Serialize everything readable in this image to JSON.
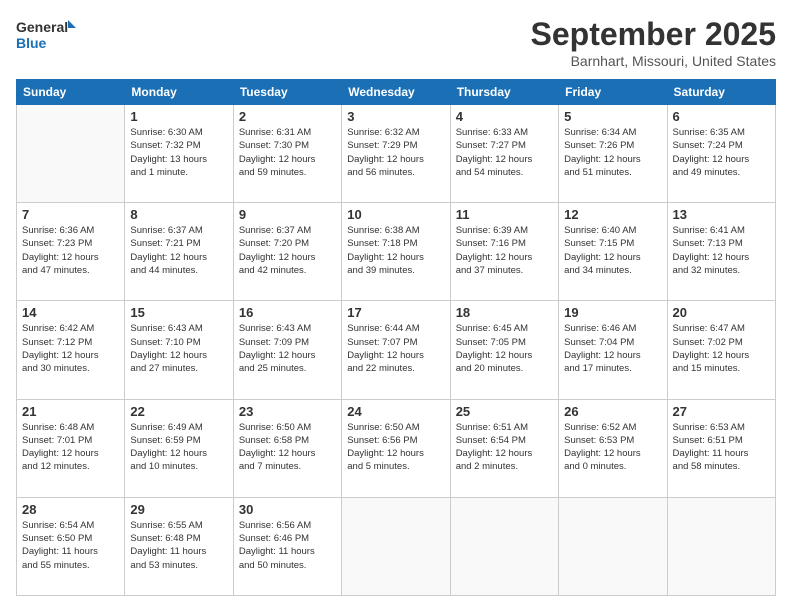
{
  "logo": {
    "line1": "General",
    "line2": "Blue"
  },
  "title": "September 2025",
  "location": "Barnhart, Missouri, United States",
  "weekdays": [
    "Sunday",
    "Monday",
    "Tuesday",
    "Wednesday",
    "Thursday",
    "Friday",
    "Saturday"
  ],
  "weeks": [
    [
      {
        "day": "",
        "info": ""
      },
      {
        "day": "1",
        "info": "Sunrise: 6:30 AM\nSunset: 7:32 PM\nDaylight: 13 hours\nand 1 minute."
      },
      {
        "day": "2",
        "info": "Sunrise: 6:31 AM\nSunset: 7:30 PM\nDaylight: 12 hours\nand 59 minutes."
      },
      {
        "day": "3",
        "info": "Sunrise: 6:32 AM\nSunset: 7:29 PM\nDaylight: 12 hours\nand 56 minutes."
      },
      {
        "day": "4",
        "info": "Sunrise: 6:33 AM\nSunset: 7:27 PM\nDaylight: 12 hours\nand 54 minutes."
      },
      {
        "day": "5",
        "info": "Sunrise: 6:34 AM\nSunset: 7:26 PM\nDaylight: 12 hours\nand 51 minutes."
      },
      {
        "day": "6",
        "info": "Sunrise: 6:35 AM\nSunset: 7:24 PM\nDaylight: 12 hours\nand 49 minutes."
      }
    ],
    [
      {
        "day": "7",
        "info": "Sunrise: 6:36 AM\nSunset: 7:23 PM\nDaylight: 12 hours\nand 47 minutes."
      },
      {
        "day": "8",
        "info": "Sunrise: 6:37 AM\nSunset: 7:21 PM\nDaylight: 12 hours\nand 44 minutes."
      },
      {
        "day": "9",
        "info": "Sunrise: 6:37 AM\nSunset: 7:20 PM\nDaylight: 12 hours\nand 42 minutes."
      },
      {
        "day": "10",
        "info": "Sunrise: 6:38 AM\nSunset: 7:18 PM\nDaylight: 12 hours\nand 39 minutes."
      },
      {
        "day": "11",
        "info": "Sunrise: 6:39 AM\nSunset: 7:16 PM\nDaylight: 12 hours\nand 37 minutes."
      },
      {
        "day": "12",
        "info": "Sunrise: 6:40 AM\nSunset: 7:15 PM\nDaylight: 12 hours\nand 34 minutes."
      },
      {
        "day": "13",
        "info": "Sunrise: 6:41 AM\nSunset: 7:13 PM\nDaylight: 12 hours\nand 32 minutes."
      }
    ],
    [
      {
        "day": "14",
        "info": "Sunrise: 6:42 AM\nSunset: 7:12 PM\nDaylight: 12 hours\nand 30 minutes."
      },
      {
        "day": "15",
        "info": "Sunrise: 6:43 AM\nSunset: 7:10 PM\nDaylight: 12 hours\nand 27 minutes."
      },
      {
        "day": "16",
        "info": "Sunrise: 6:43 AM\nSunset: 7:09 PM\nDaylight: 12 hours\nand 25 minutes."
      },
      {
        "day": "17",
        "info": "Sunrise: 6:44 AM\nSunset: 7:07 PM\nDaylight: 12 hours\nand 22 minutes."
      },
      {
        "day": "18",
        "info": "Sunrise: 6:45 AM\nSunset: 7:05 PM\nDaylight: 12 hours\nand 20 minutes."
      },
      {
        "day": "19",
        "info": "Sunrise: 6:46 AM\nSunset: 7:04 PM\nDaylight: 12 hours\nand 17 minutes."
      },
      {
        "day": "20",
        "info": "Sunrise: 6:47 AM\nSunset: 7:02 PM\nDaylight: 12 hours\nand 15 minutes."
      }
    ],
    [
      {
        "day": "21",
        "info": "Sunrise: 6:48 AM\nSunset: 7:01 PM\nDaylight: 12 hours\nand 12 minutes."
      },
      {
        "day": "22",
        "info": "Sunrise: 6:49 AM\nSunset: 6:59 PM\nDaylight: 12 hours\nand 10 minutes."
      },
      {
        "day": "23",
        "info": "Sunrise: 6:50 AM\nSunset: 6:58 PM\nDaylight: 12 hours\nand 7 minutes."
      },
      {
        "day": "24",
        "info": "Sunrise: 6:50 AM\nSunset: 6:56 PM\nDaylight: 12 hours\nand 5 minutes."
      },
      {
        "day": "25",
        "info": "Sunrise: 6:51 AM\nSunset: 6:54 PM\nDaylight: 12 hours\nand 2 minutes."
      },
      {
        "day": "26",
        "info": "Sunrise: 6:52 AM\nSunset: 6:53 PM\nDaylight: 12 hours\nand 0 minutes."
      },
      {
        "day": "27",
        "info": "Sunrise: 6:53 AM\nSunset: 6:51 PM\nDaylight: 11 hours\nand 58 minutes."
      }
    ],
    [
      {
        "day": "28",
        "info": "Sunrise: 6:54 AM\nSunset: 6:50 PM\nDaylight: 11 hours\nand 55 minutes."
      },
      {
        "day": "29",
        "info": "Sunrise: 6:55 AM\nSunset: 6:48 PM\nDaylight: 11 hours\nand 53 minutes."
      },
      {
        "day": "30",
        "info": "Sunrise: 6:56 AM\nSunset: 6:46 PM\nDaylight: 11 hours\nand 50 minutes."
      },
      {
        "day": "",
        "info": ""
      },
      {
        "day": "",
        "info": ""
      },
      {
        "day": "",
        "info": ""
      },
      {
        "day": "",
        "info": ""
      }
    ]
  ]
}
